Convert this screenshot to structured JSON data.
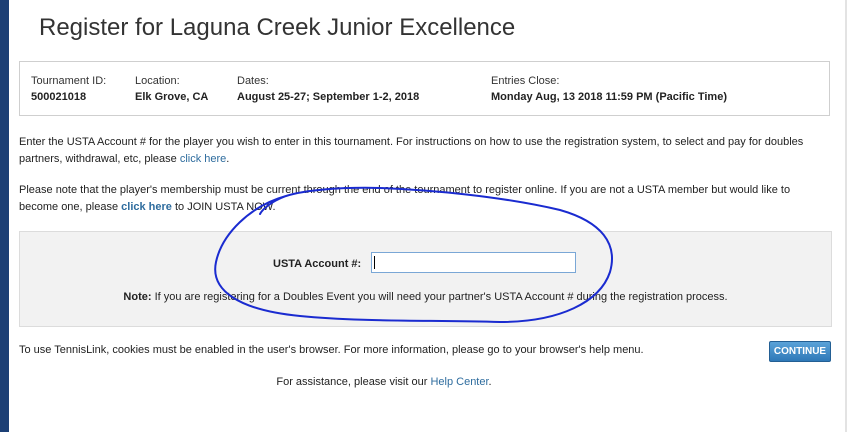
{
  "page": {
    "title": "Register for Laguna Creek Junior Excellence"
  },
  "tournament_info": {
    "tournament_id": {
      "label": "Tournament ID:",
      "value": "500021018"
    },
    "location": {
      "label": "Location:",
      "value": "Elk Grove, CA"
    },
    "dates": {
      "label": "Dates:",
      "value": "August 25-27; September 1-2, 2018"
    },
    "entries_close": {
      "label": "Entries Close:",
      "value": "Monday Aug, 13 2018 11:59 PM (Pacific Time)"
    }
  },
  "instructions": {
    "text_before_link": "Enter the USTA Account # for the player you wish to enter in this tournament. For instructions on how to use the registration system, to select and pay for doubles partners, withdrawal, etc, please ",
    "link": "click here",
    "text_after_link": "."
  },
  "membership_note": {
    "text_before_link": "Please note that the player's membership must be current through the end of the tournament to register online. If you are not a USTA member but would like to become one, please ",
    "link": "click here",
    "text_after_link": " to JOIN USTA NOW."
  },
  "account_form": {
    "label": "USTA Account #:",
    "input_value": "",
    "note_label": "Note:",
    "note_text": " If you are registering for a Doubles Event you will need your partner's USTA Account # during the registration process."
  },
  "cookies_text": "To use TennisLink, cookies must be enabled in the user's browser. For more information, please go to your browser's help menu.",
  "continue_button": "CONTINUE",
  "assistance": {
    "text": "For assistance, please visit our ",
    "link": "Help Center",
    "suffix": "."
  },
  "colors": {
    "sidebar": "#1c3f75",
    "link": "#2e6c9e",
    "button": "#3a85c4",
    "annotation": "#1a2bd0"
  }
}
